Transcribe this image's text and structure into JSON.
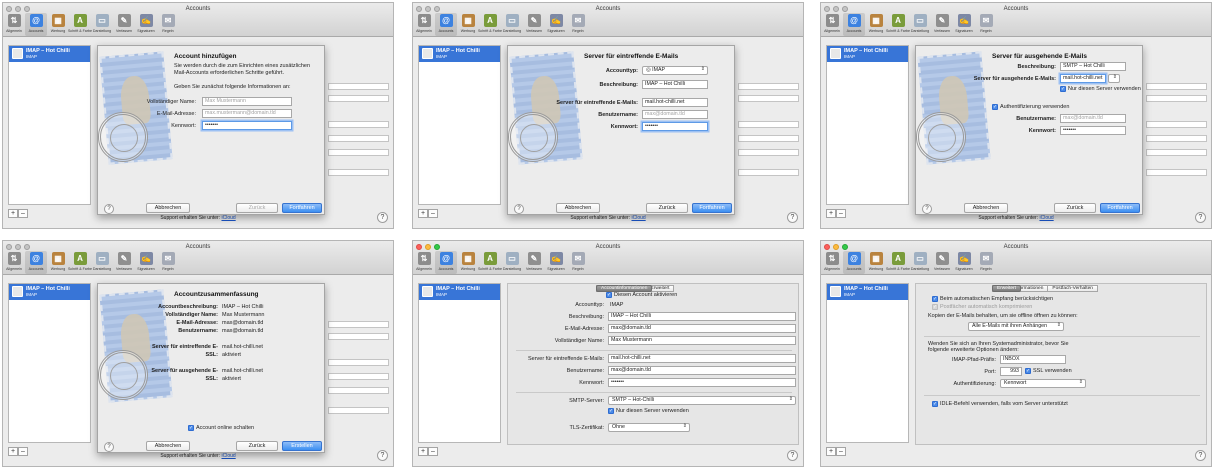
{
  "window": {
    "title": "Accounts",
    "toolbar": [
      {
        "label": "Allgemein",
        "icon": "switch-icon",
        "glyph": "⇅",
        "color": "#8c8c8c"
      },
      {
        "label": "Accounts",
        "icon": "at-icon",
        "glyph": "@",
        "color": "#3d82e0"
      },
      {
        "label": "Werbung",
        "icon": "junk-icon",
        "glyph": "▦",
        "color": "#b9833e"
      },
      {
        "label": "Schrift & Farbe",
        "icon": "fonts-colors-icon",
        "glyph": "A",
        "color": "#7a9c3b"
      },
      {
        "label": "Darstellung",
        "icon": "viewing-icon",
        "glyph": "▭",
        "color": "#9fb0c2"
      },
      {
        "label": "Verfassen",
        "icon": "compose-icon",
        "glyph": "✎",
        "color": "#8f8f8f"
      },
      {
        "label": "Signaturen",
        "icon": "signature-icon",
        "glyph": "✍",
        "color": "#7d88a5"
      },
      {
        "label": "Regeln",
        "icon": "rules-icon",
        "glyph": "✉",
        "color": "#a4aab6"
      }
    ],
    "account_name": "IMAP – Hot Chilli",
    "account_type": "IMAP",
    "support_text": "Support erhalten Sie unter:",
    "support_link": "iCloud",
    "add_symbol": "+",
    "remove_symbol": "–",
    "help_symbol": "?"
  },
  "s1": {
    "title": "Account hinzufügen",
    "intro1": "Sie werden durch die zum Einrichten eines zusätzlichen",
    "intro2": "Mail-Accounts erforderlichen Schritte geführt.",
    "intro3": "Geben Sie zunächst folgende Informationen an:",
    "name_label": "Vollständiger Name:",
    "name_placeholder": "Max Mustermann",
    "email_label": "E-Mail-Adresse:",
    "email_placeholder": "max.mustermann@domain.tld",
    "password_label": "Kennwort:",
    "password_value": "•••••••",
    "cancel": "Abbrechen",
    "back": "Zurück",
    "next": "Fortfahren"
  },
  "s2": {
    "title": "Server für eintreffende E-Mails",
    "type_label": "Accounttyp:",
    "type_value": "IMAP",
    "desc_label": "Beschreibung:",
    "desc_value": "IMAP – Hot Chilli",
    "server_label": "Server für eintreffende E-Mails:",
    "server_value": "mail.hot-chilli.net",
    "user_label": "Benutzername:",
    "user_placeholder": "max@domain.tld",
    "pass_label": "Kennwort:",
    "pass_value": "•••••••",
    "cancel": "Abbrechen",
    "back": "Zurück",
    "next": "Fortfahren"
  },
  "s3": {
    "title": "Server für ausgehende E-Mails",
    "desc_label": "Beschreibung:",
    "desc_value": "SMTP – Hot Chilli",
    "server_label": "Server für ausgehende E-Mails:",
    "server_value": "mail.hot-chilli.net",
    "only_this": "Nur diesen Server verwenden",
    "auth": "Authentifizierung verwenden",
    "user_label": "Benutzername:",
    "user_placeholder": "max@domain.tld",
    "pass_label": "Kennwort:",
    "pass_value": "•••••••",
    "cancel": "Abbrechen",
    "back": "Zurück",
    "next": "Fortfahren"
  },
  "s4": {
    "title": "Accountzusammenfassung",
    "rows": [
      {
        "label": "Accountbeschreibung:",
        "value": "IMAP – Hot Chilli"
      },
      {
        "label": "Vollständiger Name:",
        "value": "Max Mustermann"
      },
      {
        "label": "E-Mail-Adresse:",
        "value": "max@domain.tld"
      },
      {
        "label": "Benutzername:",
        "value": "max@domain.tld"
      }
    ],
    "in_label": "Server für eintreffende E-",
    "in_value": "mail.hot-chilli.net",
    "ssl_label": "SSL:",
    "ssl_value": "aktiviert",
    "out_label": "Server für ausgehende E-",
    "out_value": "mail.hot-chilli.net",
    "ssl2_value": "aktiviert",
    "online": "Account online schalten",
    "cancel": "Abbrechen",
    "back": "Zurück",
    "create": "Erstellen"
  },
  "p5": {
    "tabs": [
      "Accountinformationen",
      "Postfach-Verhalten",
      "Erweitert"
    ],
    "enable": "Diesen Account aktivieren",
    "type_label": "Accounttyp:",
    "type_value": "IMAP",
    "fields": [
      {
        "label": "Beschreibung:",
        "value": "IMAP – Hot Chilli"
      },
      {
        "label": "E-Mail-Adresse:",
        "value": "max@domain.tld"
      },
      {
        "label": "Vollständiger Name:",
        "value": "Max Mustermann"
      },
      {
        "label": "Server für eintreffende E-Mails:",
        "value": "mail.hot-chilli.net"
      },
      {
        "label": "Benutzername:",
        "value": "max@domain.tld"
      },
      {
        "label": "Kennwort:",
        "value": "•••••••"
      }
    ],
    "smtp_label": "SMTP-Server:",
    "smtp_value": "SMTP – Hot-Chilli",
    "only_this": "Nur diesen Server verwenden",
    "tls_label": "TLS-Zertifikat:",
    "tls_value": "Ohne"
  },
  "p6": {
    "tabs": [
      "Accountinformationen",
      "Postfach-Verhalten",
      "Erweitert"
    ],
    "auto": "Beim automatischen Empfang berücksichtigen",
    "compact": "Postfächer automatisch komprimieren",
    "copies": "Kopien der E-Mails behalten, um sie offline öffnen zu können:",
    "copies_value": "Alle E-Mails mit ihren Anhängen",
    "admin1": "Wenden Sie sich an Ihren Systemadministrator, bevor Sie",
    "admin2": "folgende erweiterte Optionen ändern:",
    "prefix_label": "IMAP-Pfad-Präfix:",
    "prefix_value": "INBOX",
    "port_label": "Port:",
    "port_value": "993",
    "ssl": "SSL verwenden",
    "auth_label": "Authentifizierung:",
    "auth_value": "Kennwort",
    "idle": "IDLE-Befehl verwenden, falls vom Server unterstützt"
  }
}
